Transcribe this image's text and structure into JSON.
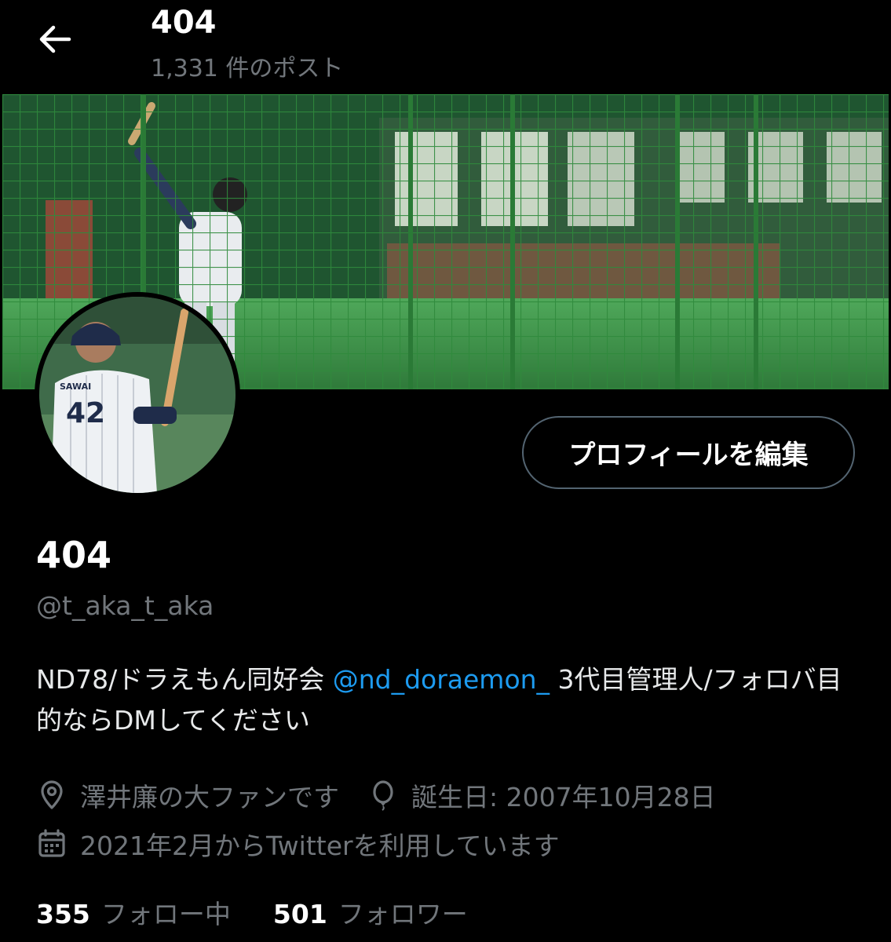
{
  "header": {
    "title": "404",
    "post_count": "1,331 件のポスト"
  },
  "profile": {
    "display_name": "404",
    "handle": "@t_aka_t_aka",
    "edit_button": "プロフィールを編集",
    "bio": {
      "before": "ND78/ドラえもん同好会 ",
      "mention": "@nd_doraemon_",
      "after": " 3代目管理人/フォロバ目的ならDMしてください"
    },
    "location": "澤井廉の大ファンです",
    "birthday": "誕生日: 2007年10月28日",
    "joined": "2021年2月からTwitterを利用しています",
    "avatar_jersey_name": "SAWAI",
    "avatar_jersey_number": "42"
  },
  "stats": {
    "following_count": "355",
    "following_label": "フォロー中",
    "followers_count": "501",
    "followers_label": "フォロワー"
  },
  "colors": {
    "background": "#000000",
    "link": "#1d9bf0",
    "muted": "#71767b",
    "net_green": "#2e7d3a"
  },
  "icons": [
    "back-arrow-icon",
    "location-icon",
    "balloon-icon",
    "calendar-icon"
  ]
}
